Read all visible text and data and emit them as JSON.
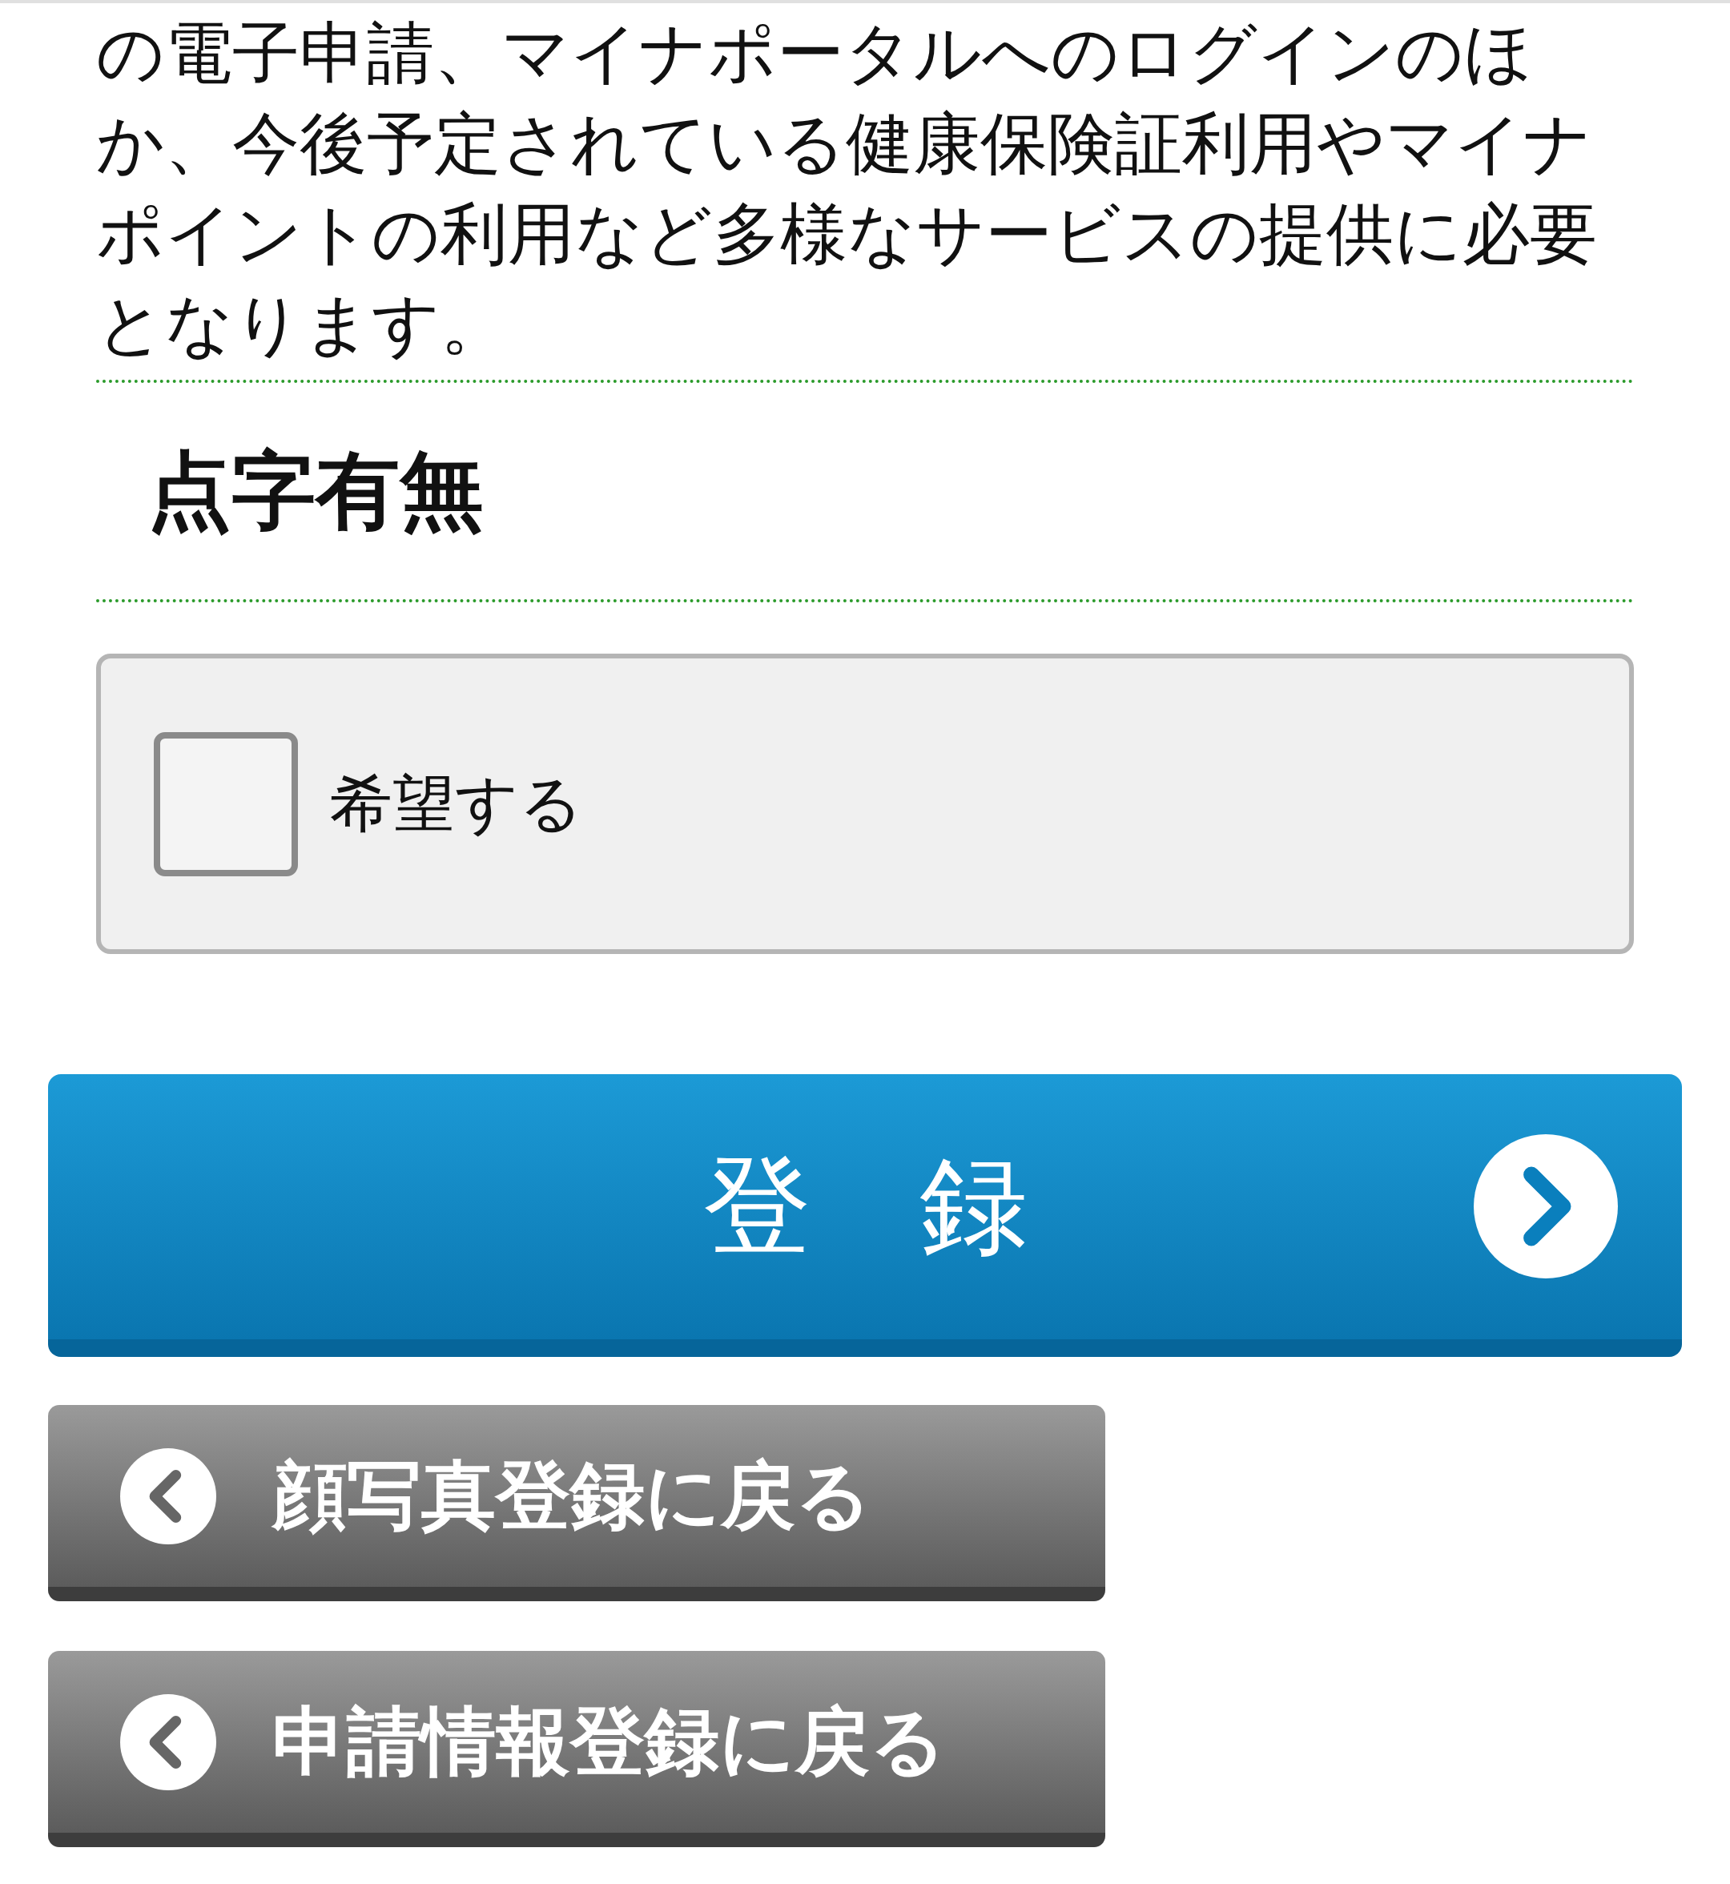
{
  "intro_text": "の電子申請、マイナポータルへのログインのほか、今後予定されている健康保険証利用やマイナポイントの利用など多様なサービスの提供に必要となります。",
  "section": {
    "heading": "点字有無",
    "option": {
      "label": "希望する",
      "checked": false
    }
  },
  "primary_button": {
    "label": "登　録"
  },
  "back_buttons": [
    {
      "label": "顔写真登録に戻る"
    },
    {
      "label": "申請情報登録に戻る"
    }
  ]
}
